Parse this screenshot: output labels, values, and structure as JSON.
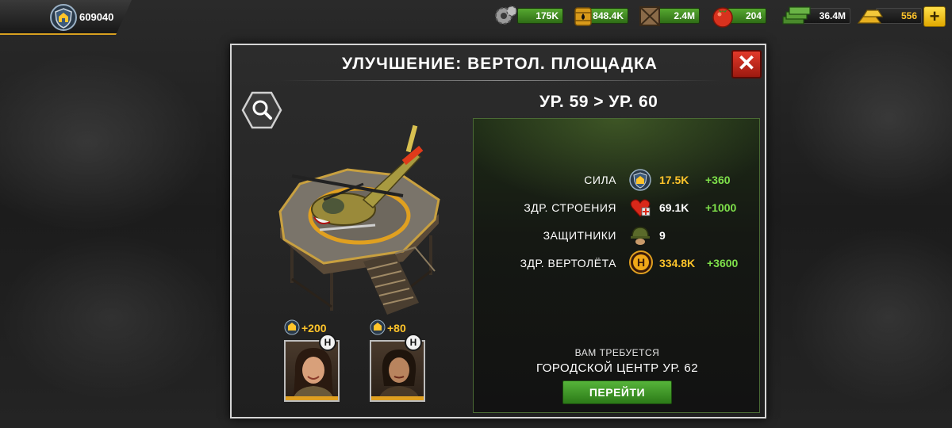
{
  "header": {
    "power_value": "609040",
    "resources": [
      {
        "icon": "gear-parts-icon",
        "value": "175K"
      },
      {
        "icon": "oil-barrel-icon",
        "value": "848.4K"
      },
      {
        "icon": "supply-crate-icon",
        "value": "2.4M"
      },
      {
        "icon": "food-tomato-icon",
        "value": "204"
      },
      {
        "icon": "cash-stack-icon",
        "value": "36.4M"
      },
      {
        "icon": "gold-bars-icon",
        "value": "556"
      }
    ],
    "add_label": "+"
  },
  "dialog": {
    "title": "УЛУЧШЕНИЕ: ВЕРТОЛ. ПЛОЩАДКА",
    "close_label": "✕",
    "level_text": "УР. 59 > УР. 60",
    "stats": [
      {
        "label": "СИЛА",
        "icon": "power-shield-icon",
        "value": "17.5K",
        "bonus": "+360",
        "value_color": "#ffc42a"
      },
      {
        "label": "ЗДР. СТРОЕНИЯ",
        "icon": "heart-health-icon",
        "value": "69.1K",
        "bonus": "+1000",
        "value_color": "#ffffff"
      },
      {
        "label": "ЗАЩИТНИКИ",
        "icon": "soldier-helmet-icon",
        "value": "9",
        "bonus": "",
        "value_color": "#ffffff"
      },
      {
        "label": "ЗДР. ВЕРТОЛЁТА",
        "icon": "helipad-h-icon",
        "value": "334.8K",
        "bonus": "+3600",
        "value_color": "#ffc42a"
      }
    ],
    "requirement": {
      "label": "ВАМ ТРЕБУЕТСЯ",
      "value": "ГОРОДСКОЙ ЦЕНТР УР. 62",
      "button_label": "ПЕРЕЙТИ"
    },
    "heroes": [
      {
        "bonus": "+200",
        "badge": "H"
      },
      {
        "bonus": "+80",
        "badge": "H"
      }
    ]
  }
}
